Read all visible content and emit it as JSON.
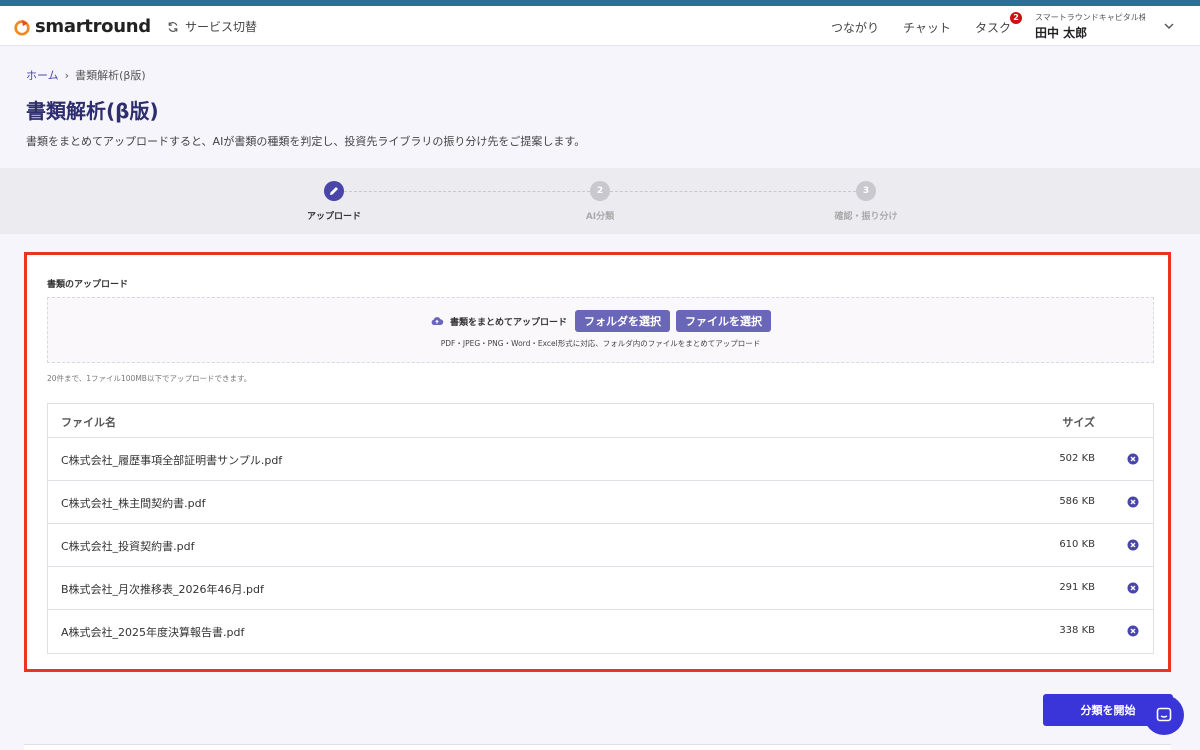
{
  "header": {
    "logo_text": "smartround",
    "service_switch_label": "サービス切替",
    "nav": [
      {
        "label": "つながり"
      },
      {
        "label": "チャット"
      },
      {
        "label": "タスク"
      }
    ],
    "task_badge": "2",
    "user_org": "スマートラウンドキャピタル株式…",
    "user_name": "田中 太郎"
  },
  "breadcrumb": {
    "home": "ホーム",
    "current": "書類解析(β版)"
  },
  "page": {
    "title": "書類解析(β版)",
    "description": "書類をまとめてアップロードすると、AIが書類の種類を判定し、投資先ライブラリの振り分け先をご提案します。"
  },
  "stepper": {
    "steps": [
      {
        "number": "",
        "label": "アップロード",
        "active": true
      },
      {
        "number": "2",
        "label": "AI分類",
        "active": false
      },
      {
        "number": "3",
        "label": "確認・振り分け",
        "active": false
      }
    ]
  },
  "upload": {
    "section_label": "書類のアップロード",
    "dropzone_label": "書類をまとめてアップロード",
    "folder_button": "フォルダを選択",
    "file_button": "ファイルを選択",
    "formats_note": "PDF・JPEG・PNG・Word・Excel形式に対応、フォルダ内のファイルをまとめてアップロード",
    "limit_note": "20件まで、1ファイル100MB以下でアップロードできます。"
  },
  "table": {
    "col_name": "ファイル名",
    "col_size": "サイズ",
    "rows": [
      {
        "name": "C株式会社_履歴事項全部証明書サンプル.pdf",
        "size": "502 KB"
      },
      {
        "name": "C株式会社_株主間契約書.pdf",
        "size": "586 KB"
      },
      {
        "name": "C株式会社_投資契約書.pdf",
        "size": "610 KB"
      },
      {
        "name": "B株式会社_月次推移表_2026年46月.pdf",
        "size": "291 KB"
      },
      {
        "name": "A株式会社_2025年度決算報告書.pdf",
        "size": "338 KB"
      }
    ]
  },
  "actions": {
    "start_label": "分類を開始"
  },
  "colors": {
    "accent": "#3a35d8",
    "highlight_border": "#ea3323",
    "step_active": "#4a45a8"
  }
}
